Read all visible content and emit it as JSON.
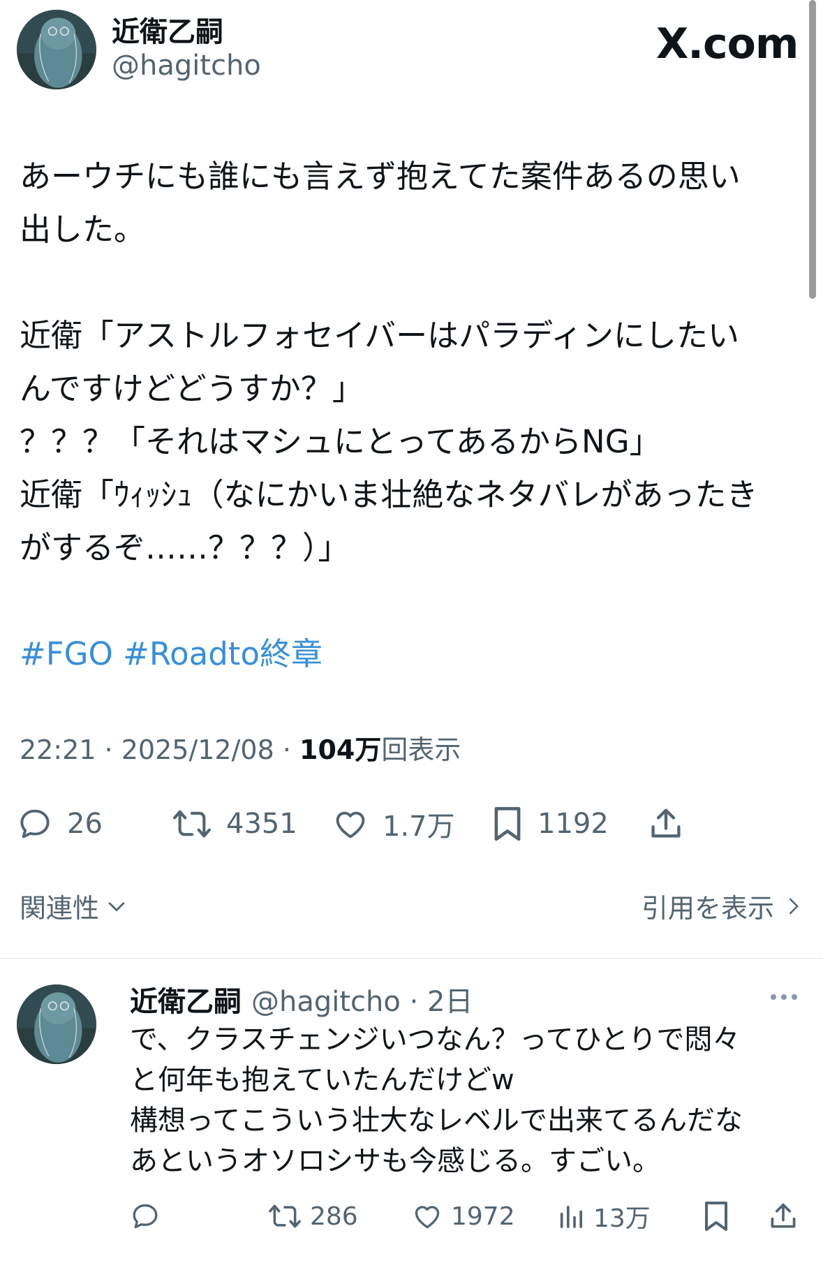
{
  "brand": "X.com",
  "tweet": {
    "author_name": "近衛乙嗣",
    "author_handle": "@hagitcho",
    "lines": [
      "あーウチにも誰にも言えず抱えてた案件あるの思い",
      "出した。",
      "",
      "近衛「アストルフォセイバーはパラディンにしたい",
      "んですけどどうすか？」",
      "？？？「それはマシュにとってあるからNG」",
      "近衛「ｳｨｯｼｭ（なにかいま壮絶なネタバレがあったき",
      "がするぞ……？？？）」",
      "",
      "#FGO #Roadto終章"
    ],
    "time": "22:21 · 2025/12/08 · ",
    "views_value": "104万",
    "views_label": "回表示",
    "replies": "26",
    "retweets": "4351",
    "likes": "1.7万",
    "bookmarks": "1192"
  },
  "filter": {
    "left_label": "関連性",
    "right_label": "引用を表示"
  },
  "reply": {
    "author_name": "近衛乙嗣",
    "handle_time": "@hagitcho · 2日",
    "lines": [
      "で、クラスチェンジいつなん？ってひとりで悶々",
      "と何年も抱えていたんだけどw",
      "構想ってこういう壮大なレベルで出来てるんだな",
      "あというオソロシサも今感じる。すごい。"
    ],
    "retweets": "286",
    "likes": "1972",
    "views": "13万"
  },
  "colors": {
    "text": "#0f1419",
    "secondary": "#536471",
    "hashtag": "#3a8fd6"
  },
  "icons": [
    "reply-icon",
    "retweet-icon",
    "like-icon",
    "bookmark-icon",
    "share-icon",
    "views-icon",
    "more-icon",
    "chevron-down-icon",
    "chevron-right-icon"
  ]
}
